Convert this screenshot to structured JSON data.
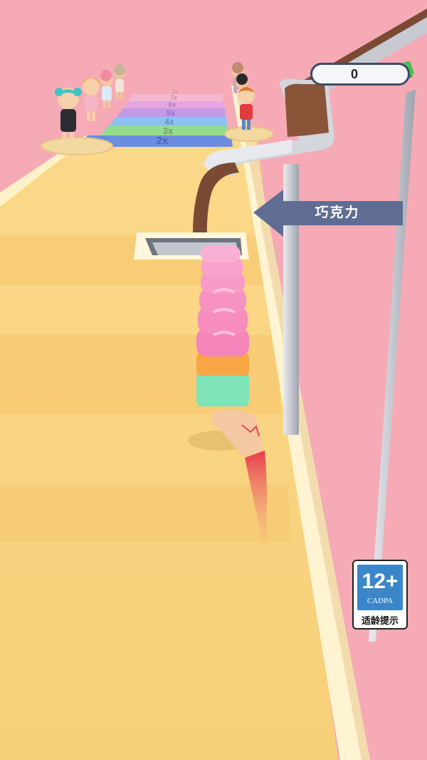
{
  "hud": {
    "money": "0",
    "money_icon": "cash-stack-icon"
  },
  "flavor_sign": {
    "label": "巧克力",
    "arrow": "arrow-left-icon"
  },
  "multipliers": [
    "2x",
    "3x",
    "4x",
    "5x",
    "6x",
    "7x",
    "8x"
  ],
  "age_rating": {
    "rating": "12+",
    "org": "CADPA",
    "hint": "适龄提示"
  },
  "colors": {
    "background": "#f6aab5",
    "track": "#f8cf7a",
    "chocolate": "#7a4a34",
    "badge_blue": "#3b86c8"
  }
}
